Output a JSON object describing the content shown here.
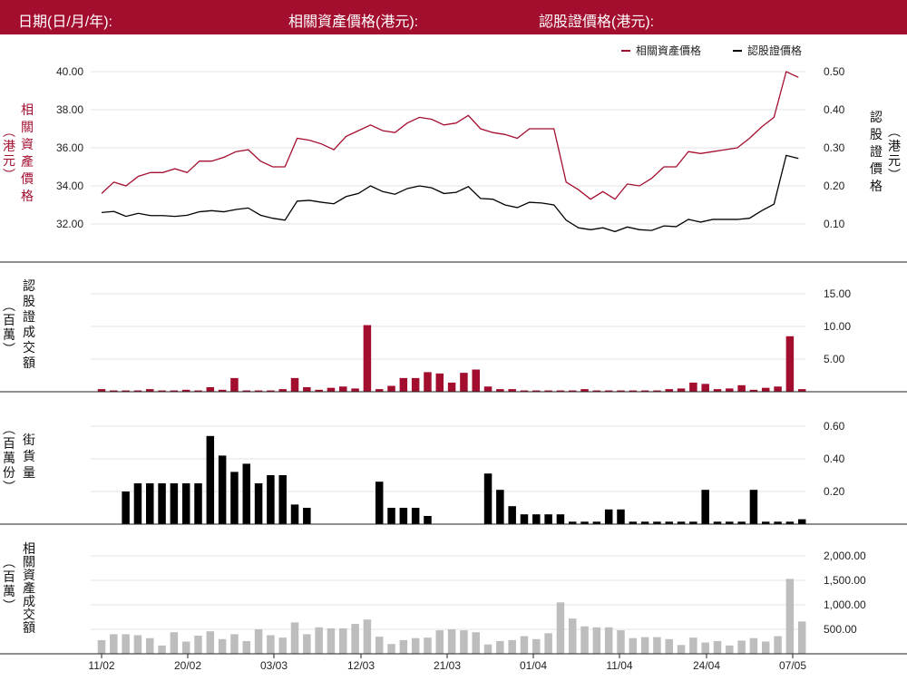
{
  "header": {
    "date_label": "日期(日/月/年):",
    "underlying_price_label": "相關資產價格(港元):",
    "warrant_price_label": "認股證價格(港元):"
  },
  "colors": {
    "header_bg": "#a30e2f",
    "underlying": "#a30e2f",
    "warrant": "#000000",
    "outstanding": "#000000",
    "underlying_turnover": "#bdbdbd",
    "grid": "#e3e3e3"
  },
  "chart_data": [
    {
      "type": "line",
      "legend": [
        "相關資產價格",
        "認股證價格"
      ],
      "legend_position": "top-right",
      "ylabel_left": "相關資產價格 (港元)",
      "ylabel_right": "認股證價格 (港元)",
      "y_left_ticks": [
        "40.00",
        "38.00",
        "36.00",
        "34.00",
        "32.00"
      ],
      "y_right_ticks": [
        "0.50",
        "0.40",
        "0.30",
        "0.20",
        "0.10"
      ],
      "ylim_left": [
        30.8,
        41.2
      ],
      "ylim_right": [
        0.04,
        0.54
      ],
      "series": [
        {
          "name": "相關資產價格",
          "axis": "left",
          "values": [
            33.6,
            34.2,
            34.0,
            34.5,
            34.7,
            34.7,
            34.9,
            34.7,
            35.3,
            35.3,
            35.5,
            35.8,
            35.9,
            35.3,
            35.0,
            35.0,
            36.5,
            36.4,
            36.2,
            35.9,
            36.6,
            36.9,
            37.2,
            36.9,
            36.8,
            37.3,
            37.6,
            37.5,
            37.2,
            37.3,
            37.7,
            37.0,
            36.8,
            36.7,
            36.5,
            37.0,
            37.0,
            37.0,
            34.2,
            33.8,
            33.3,
            33.7,
            33.3,
            34.1,
            34.0,
            34.4,
            35.0,
            35.0,
            35.8,
            35.7,
            35.8,
            35.9,
            36.0,
            36.5,
            37.1,
            37.6,
            40.0,
            39.7
          ]
        },
        {
          "name": "認股證價格",
          "axis": "right",
          "values": [
            0.13,
            0.133,
            0.12,
            0.128,
            0.122,
            0.122,
            0.12,
            0.123,
            0.132,
            0.135,
            0.132,
            0.138,
            0.142,
            0.123,
            0.115,
            0.11,
            0.16,
            0.162,
            0.157,
            0.153,
            0.172,
            0.18,
            0.2,
            0.185,
            0.178,
            0.193,
            0.2,
            0.195,
            0.18,
            0.183,
            0.198,
            0.167,
            0.165,
            0.15,
            0.143,
            0.157,
            0.155,
            0.15,
            0.11,
            0.09,
            0.085,
            0.09,
            0.08,
            0.092,
            0.085,
            0.083,
            0.095,
            0.093,
            0.112,
            0.105,
            0.112,
            0.112,
            0.112,
            0.115,
            0.135,
            0.152,
            0.28,
            0.272
          ]
        }
      ]
    },
    {
      "type": "bar",
      "ylabel": "認股證成交額 (百萬)",
      "y_ticks": [
        "15.00",
        "10.00",
        "5.00"
      ],
      "ylim": [
        0,
        17.5
      ],
      "values": [
        0.4,
        0.2,
        0.2,
        0.2,
        0.4,
        0.2,
        0.2,
        0.3,
        0.2,
        0.7,
        0.3,
        2.1,
        0.2,
        0.2,
        0.2,
        0.4,
        2.1,
        0.7,
        0.3,
        0.6,
        0.8,
        0.5,
        10.2,
        0.4,
        0.9,
        2.1,
        2.1,
        3.0,
        2.8,
        1.4,
        2.9,
        3.4,
        0.8,
        0.4,
        0.4,
        0.2,
        0.2,
        0.2,
        0.2,
        0.2,
        0.4,
        0.2,
        0.2,
        0.2,
        0.2,
        0.2,
        0.2,
        0.4,
        0.5,
        1.4,
        1.2,
        0.4,
        0.5,
        1.0,
        0.3,
        0.6,
        0.8,
        8.5,
        0.4
      ]
    },
    {
      "type": "bar",
      "ylabel": "街貨量 (百萬份)",
      "y_ticks": [
        "0.60",
        "0.40",
        "0.20"
      ],
      "ylim": [
        0,
        0.68
      ],
      "values": [
        0,
        0,
        0.2,
        0.25,
        0.25,
        0.25,
        0.25,
        0.25,
        0.25,
        0.54,
        0.42,
        0.32,
        0.37,
        0.25,
        0.3,
        0.3,
        0.12,
        0.1,
        0,
        0,
        0,
        0,
        0,
        0.26,
        0.1,
        0.1,
        0.1,
        0.05,
        0,
        0,
        0,
        0,
        0.31,
        0.21,
        0.11,
        0.06,
        0.06,
        0.06,
        0.06,
        0.015,
        0.015,
        0.015,
        0.09,
        0.09,
        0.015,
        0.015,
        0.015,
        0.015,
        0.015,
        0.015,
        0.21,
        0.015,
        0.015,
        0.015,
        0.21,
        0.015,
        0.015,
        0.015,
        0.03
      ]
    },
    {
      "type": "bar",
      "ylabel": "相關資產成交額 (百萬)",
      "y_ticks": [
        "2,000.00",
        "1,500.00",
        "1,000.00",
        "500.00"
      ],
      "ylim": [
        0,
        2250
      ],
      "x_tick_labels": [
        "11/02",
        "20/02",
        "03/03",
        "12/03",
        "21/03",
        "01/04",
        "11/04",
        "24/04",
        "07/05"
      ],
      "values": [
        280,
        400,
        400,
        380,
        320,
        170,
        440,
        250,
        370,
        460,
        300,
        400,
        260,
        500,
        380,
        330,
        640,
        400,
        540,
        520,
        520,
        610,
        700,
        350,
        200,
        280,
        320,
        330,
        480,
        500,
        480,
        440,
        190,
        260,
        280,
        360,
        300,
        420,
        1050,
        720,
        560,
        540,
        540,
        480,
        320,
        340,
        340,
        300,
        180,
        330,
        230,
        260,
        170,
        270,
        320,
        250,
        360,
        1530,
        660
      ]
    }
  ]
}
